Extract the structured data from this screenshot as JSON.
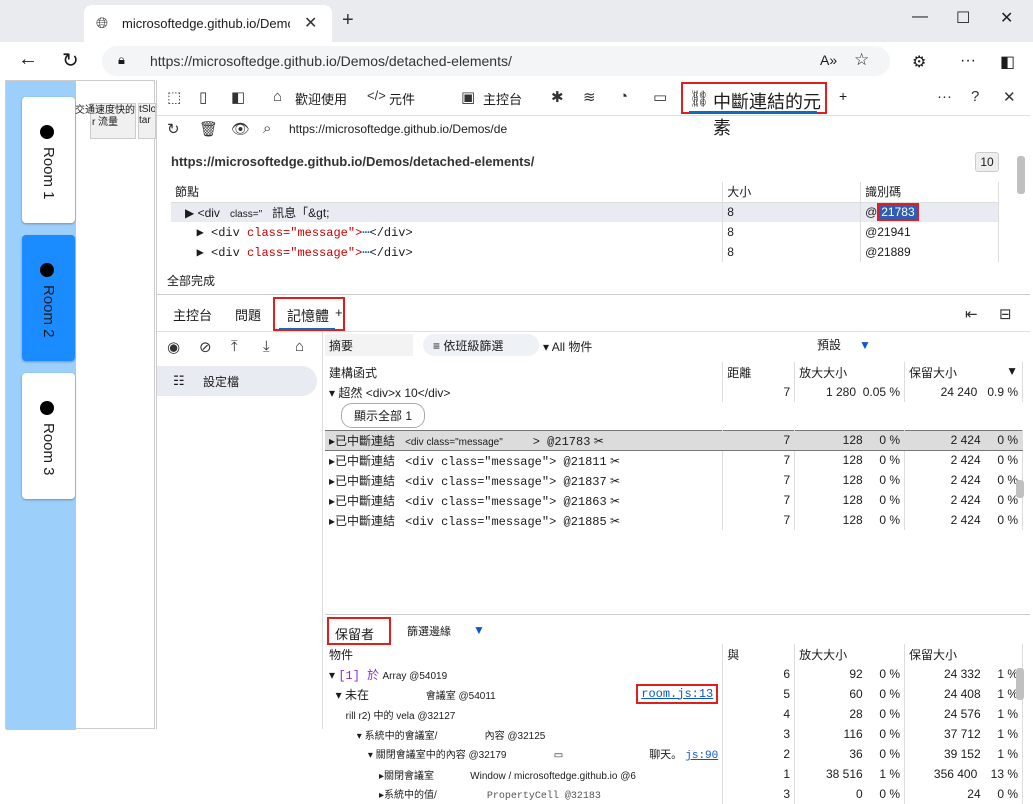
{
  "browser": {
    "tab_title": "microsoftedge.github.io/Demos/d",
    "url": "https://microsoftedge.github.io/Demos/detached-elements/"
  },
  "page": {
    "rooms": [
      "Room 1",
      "Room 2",
      "Room 3"
    ],
    "chip_text": "交通速度快的 r 流量",
    "chip_small": "tSlo tar"
  },
  "devtools": {
    "tabs": {
      "welcome": "歡迎使用",
      "elements": "元件",
      "console": "主控台",
      "detached": "中斷連結的元素",
      "plus": "+"
    },
    "url_box": "https://microsoftedge.github.io/Demos/de",
    "page_url": "https://microsoftedge.github.io/Demos/detached-elements/",
    "count": "10",
    "detached_table": {
      "headers": [
        "節點",
        "大小",
        "識別碼"
      ],
      "rows": [
        {
          "node_pre": "<div",
          "node_attr": "class=\"",
          "node_txt": "訊息「&gt;",
          "size": "8",
          "id_prefix": "@",
          "id": "21783"
        },
        {
          "node_pre": "<div",
          "node_attr": "class=\"message\">",
          "node_txt": "</div>",
          "size": "8",
          "id_prefix": "",
          "id": "@21941"
        },
        {
          "node_pre": "<div",
          "node_attr": "class=\"message\">",
          "node_txt": "</div>",
          "size": "8",
          "id_prefix": "",
          "id": "@21889"
        }
      ]
    },
    "status": "全部完成",
    "bottom_tabs": {
      "console": "主控台",
      "issues": "問題",
      "memory": "記憶體",
      "plus": "+"
    },
    "memory": {
      "profiles_label": "設定檔",
      "filter": {
        "summary": "摘要",
        "class_filter": "依班級篩選",
        "all_objects": "All 物件",
        "default": "預設"
      },
      "constructors": {
        "headers": [
          "建構函式",
          "距離",
          "放大大小",
          "保留大小"
        ],
        "group": {
          "label": "超然 <div>x 10</div>",
          "distance": "7",
          "shallow": "1 280",
          "shallow_pct": "0.05 %",
          "retained": "24 240",
          "retained_pct": "0.9 %"
        },
        "show_all": "顯示全部 1",
        "rows": [
          {
            "label": "已中斷連結",
            "tag": "<div class=\"message\"",
            "id": "> @21783",
            "distance": "7",
            "shallow": "128",
            "shallow_pct": "0 %",
            "retained": "2 424",
            "retained_pct": "0 %"
          },
          {
            "label": "已中斷連結",
            "tag": "<div    class=\"message\"> @21811",
            "id": "",
            "distance": "7",
            "shallow": "128",
            "shallow_pct": "0 %",
            "retained": "2 424",
            "retained_pct": "0 %"
          },
          {
            "label": "已中斷連結",
            "tag": "<div    class=\"message\"> @21837",
            "id": "",
            "distance": "7",
            "shallow": "128",
            "shallow_pct": "0 %",
            "retained": "2 424",
            "retained_pct": "0 %"
          },
          {
            "label": "已中斷連結",
            "tag": "<div    class=\"message\"> @21863",
            "id": "",
            "distance": "7",
            "shallow": "128",
            "shallow_pct": "0 %",
            "retained": "2 424",
            "retained_pct": "0 %"
          },
          {
            "label": "已中斷連結",
            "tag": "<div    class=\"message\"> @21885",
            "id": "",
            "distance": "7",
            "shallow": "128",
            "shallow_pct": "0 %",
            "retained": "2 424",
            "retained_pct": "0 %"
          }
        ]
      },
      "retainers": {
        "tab": "保留者",
        "filter_edges": "篩選邊緣",
        "headers": [
          "物件",
          "與",
          "放大大小",
          "保留大小"
        ],
        "rows": [
          {
            "label": "[1] 於",
            "extra": "Array @54019",
            "link": "",
            "distance": "6",
            "shallow": "92",
            "shallow_pct": "0 %",
            "retained": "24 332",
            "retained_pct": "1 %"
          },
          {
            "label": "未在",
            "extra": "會議室 @54011",
            "link": "room.js:13",
            "distance": "5",
            "shallow": "60",
            "shallow_pct": "0 %",
            "retained": "24 408",
            "retained_pct": "1 %"
          },
          {
            "label": "rill r2) 中的",
            "extra": "vela @32127",
            "link": "",
            "distance": "4",
            "shallow": "28",
            "shallow_pct": "0 %",
            "retained": "24 576",
            "retained_pct": "1 %"
          },
          {
            "label": "系統中的會議室/",
            "extra": "內容 @32125",
            "link": "",
            "distance": "3",
            "shallow": "116",
            "shallow_pct": "0 %",
            "retained": "37 712",
            "retained_pct": "1 %"
          },
          {
            "label": "關閉會議室中的內容",
            "extra": "@32179",
            "link": "js:90",
            "link_pre": "聊天。",
            "distance": "2",
            "shallow": "36",
            "shallow_pct": "0 %",
            "retained": "39 152",
            "retained_pct": "1 %"
          },
          {
            "label": "關閉會議室",
            "extra": "Window / microsoftedge.github.io @6",
            "link": "",
            "distance": "1",
            "shallow": "38 516",
            "shallow_pct": "1 %",
            "retained": "356 400",
            "retained_pct": "13 %"
          },
          {
            "label": "系統中的值/",
            "extra": "PropertyCell @32183",
            "link": "",
            "distance": "3",
            "shallow": "0",
            "shallow_pct": "0 %",
            "retained": "24",
            "retained_pct": "0 %"
          }
        ]
      }
    }
  }
}
